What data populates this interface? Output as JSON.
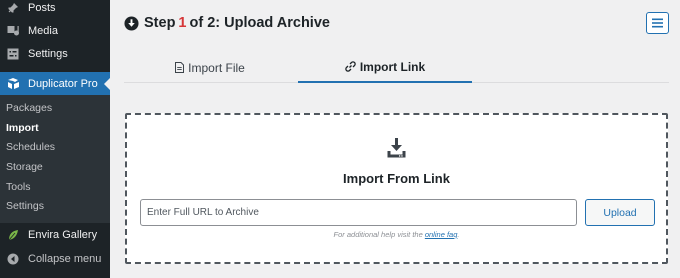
{
  "sidebar": {
    "items_top": [
      {
        "label": "Posts",
        "icon": "pin-icon"
      },
      {
        "label": "Media",
        "icon": "media-icon"
      },
      {
        "label": "Settings",
        "icon": "settings-icon"
      }
    ],
    "active": {
      "label": "Duplicator Pro",
      "icon": "duplicator-icon"
    },
    "submenu": [
      "Packages",
      "Import",
      "Schedules",
      "Storage",
      "Tools",
      "Settings"
    ],
    "current_submenu": "Import",
    "envira": {
      "label": "Envira Gallery",
      "icon": "leaf-icon"
    },
    "collapse": {
      "label": "Collapse menu",
      "icon": "collapse-icon"
    }
  },
  "header": {
    "prefix": "Step",
    "step_current": "1",
    "suffix": "of 2: Upload Archive"
  },
  "tabs": [
    {
      "label": "Import File",
      "icon": "file-icon"
    },
    {
      "label": "Import Link",
      "icon": "link-icon",
      "active": true
    }
  ],
  "import": {
    "title": "Import From Link",
    "url_placeholder": "Enter Full URL to Archive",
    "upload_label": "Upload",
    "help_text": "For additional help visit the ",
    "help_link": "online faq",
    "help_end": "."
  },
  "colors": {
    "sidebar_bg": "#1d2327",
    "accent": "#2271b1",
    "step_red": "#d63638"
  }
}
